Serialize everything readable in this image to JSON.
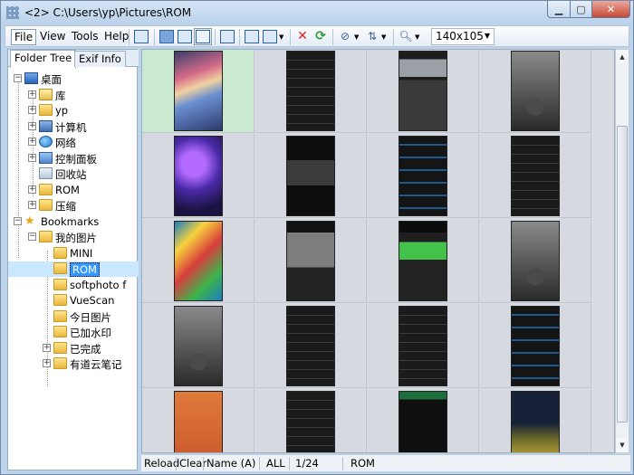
{
  "window": {
    "title": "<2> C:\\Users\\yp\\Pictures\\ROM",
    "min_label": "▁",
    "max_label": "▢",
    "close_label": "✕"
  },
  "menu": {
    "file": "File",
    "view": "View",
    "tools": "Tools",
    "help": "Help"
  },
  "toolbar": {
    "thumb_size": "140x105"
  },
  "tabs": {
    "folder_tree": "Folder Tree",
    "exif_info": "Exif Info"
  },
  "tree": [
    {
      "label": "桌面",
      "icon": "desktop",
      "expander": "−"
    },
    {
      "label": "库",
      "icon": "library",
      "expander": "+"
    },
    {
      "label": "yp",
      "icon": "folder",
      "expander": "+"
    },
    {
      "label": "计算机",
      "icon": "computer",
      "expander": "+"
    },
    {
      "label": "网络",
      "icon": "network",
      "expander": "+"
    },
    {
      "label": "控制面板",
      "icon": "panel",
      "expander": "+"
    },
    {
      "label": "回收站",
      "icon": "bin",
      "expander": ""
    },
    {
      "label": "ROM",
      "icon": "folder",
      "expander": "+"
    },
    {
      "label": "压缩",
      "icon": "folder",
      "expander": "+"
    },
    {
      "label": "Bookmarks",
      "icon": "star",
      "expander": "−"
    },
    {
      "label": "我的图片",
      "icon": "folder",
      "expander": "−"
    },
    {
      "label": "MINI",
      "icon": "folder",
      "expander": ""
    },
    {
      "label": "ROM",
      "icon": "folder",
      "expander": ""
    },
    {
      "label": "softphoto f",
      "icon": "folder",
      "expander": ""
    },
    {
      "label": "VueScan",
      "icon": "folder",
      "expander": ""
    },
    {
      "label": "今日图片",
      "icon": "folder",
      "expander": ""
    },
    {
      "label": "已加水印",
      "icon": "folder",
      "expander": ""
    },
    {
      "label": "已完成",
      "icon": "folder",
      "expander": "+"
    },
    {
      "label": "有道云笔记",
      "icon": "folder",
      "expander": "+"
    }
  ],
  "thumbnails": [
    [
      "art-poster",
      "dark-settings",
      "dark-camera",
      "lockscreen-clock"
    ],
    [
      "purple-home",
      "dark-dialog",
      "dark-storage",
      "dark-settings"
    ],
    [
      "colorful-home",
      "dark-chart",
      "battery",
      "lockscreen-clock"
    ],
    [
      "lockscreen-clock",
      "dark-settings",
      "dark-settings",
      "dark-storage"
    ],
    [
      "orange-lock",
      "dark-settings",
      "dark-chat",
      "night-lock"
    ]
  ],
  "status": {
    "reload": "Reload",
    "clear": "Clear",
    "sort": "Name (A)",
    "filter": "ALL",
    "count": "1/24",
    "folder": "ROM"
  },
  "colors": {
    "accent": "#3399ff",
    "window_frame": "#bcd3ea",
    "close_button": "#c84a37"
  }
}
